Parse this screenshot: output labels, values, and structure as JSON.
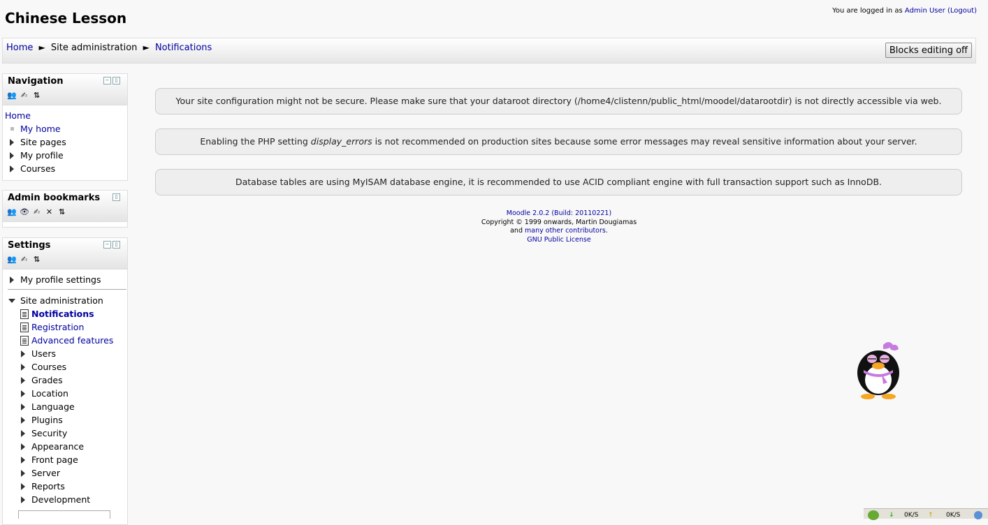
{
  "header": {
    "site_title": "Chinese Lesson",
    "login_prefix": "You are logged in as ",
    "user_name": "Admin User",
    "logout": "(Logout)"
  },
  "breadcrumb": {
    "home": "Home",
    "separator": "►",
    "site_admin": "Site administration",
    "current": "Notifications"
  },
  "blocks_editing_button": "Blocks editing off",
  "navigation_block": {
    "title": "Navigation",
    "root": "Home",
    "items": [
      "My home",
      "Site pages",
      "My profile",
      "Courses"
    ]
  },
  "admin_bookmarks_block": {
    "title": "Admin bookmarks"
  },
  "settings_block": {
    "title": "Settings",
    "my_profile_settings": "My profile settings",
    "site_administration": "Site administration",
    "pages": [
      "Notifications",
      "Registration",
      "Advanced features"
    ],
    "categories": [
      "Users",
      "Courses",
      "Grades",
      "Location",
      "Language",
      "Plugins",
      "Security",
      "Appearance",
      "Front page",
      "Server",
      "Reports",
      "Development"
    ]
  },
  "notifications": [
    "Your site configuration might not be secure. Please make sure that your dataroot directory (/home4/clistenn/public_html/moodel/datarootdir) is not directly accessible via web.",
    {
      "before": "Enabling the PHP setting ",
      "em": "display_errors",
      "after": " is not recommended on production sites because some error messages may reveal sensitive information about your server."
    },
    "Database tables are using MyISAM database engine, it is recommended to use ACID compliant engine with full transaction support such as InnoDB."
  ],
  "footer": {
    "version": "Moodle 2.0.2 (Build: 20110221)",
    "copyright": "Copyright © 1999 onwards, Martin Dougiamas",
    "and": "and ",
    "contributors": "many other contributors",
    "period": ".",
    "license": "GNU Public License"
  },
  "statusbar": {
    "down": "0K/S",
    "up": "0K/S"
  },
  "icons": {
    "collapse": "collapse-icon",
    "dock": "dock-icon",
    "assign_roles": "assign-roles-icon",
    "edit": "edit-icon",
    "move": "move-icon",
    "hide": "eye-icon",
    "delete": "delete-icon"
  }
}
